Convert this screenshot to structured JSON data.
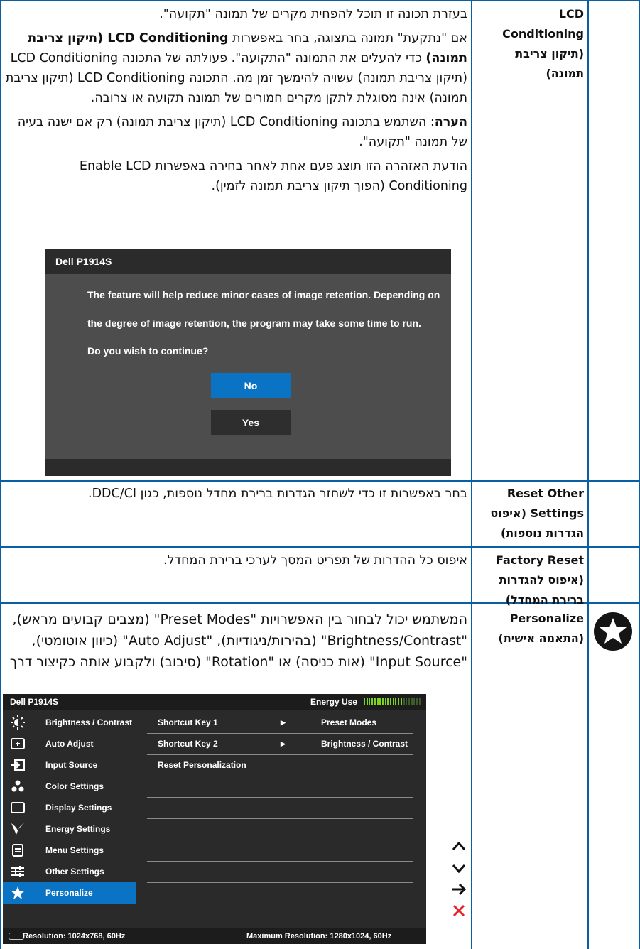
{
  "lcd": {
    "label": "LCD Conditioning (תיקון צריבת תמונה)",
    "p1": "בעזרת תכונה זו תוכל להפחית מקרים של תמונה \"תקועה\".",
    "p2_pre": "אם \"נתקעת\" תמונה בתצוגה, בחר באפשרות ",
    "p2_bold": "LCD Conditioning (תיקון צריבת תמונה)",
    "p2_post": " כדי להעלים את התמונה \"התקועה\". פעולתה של התכונה LCD Conditioning (תיקון צריבת תמונה) עשויה להימשך זמן מה. התכונה LCD Conditioning (תיקון צריבת תמונה) אינה מסוגלת לתקן מקרים חמורים של תמונה תקועה או צרובה.",
    "note_bold": "הערה",
    "note_text": ": השתמש בתכונה LCD Conditioning (תיקון צריבת תמונה) רק אם ישנה בעיה של תמונה \"תקועה\".",
    "p4": "הודעת האזהרה הזו תוצג פעם אחת לאחר בחירה באפשרות Enable LCD Conditioning (הפוך תיקון צריבת תמונה לזמין)."
  },
  "dialog": {
    "title": "Dell P1914S",
    "line1": "The feature will help reduce minor cases of image retention. Depending on",
    "line2": "the degree of image retention, the program may take some time to run.",
    "line3": "Do you wish to continue?",
    "no_label": "No",
    "yes_label": "Yes",
    "no_color": "#0a73c4",
    "yes_color": "#2e2e2e"
  },
  "reset_other": {
    "label": "Reset Other Settings (איפוס הגדרות נוספות)",
    "text": "בחר באפשרות זו כדי לשחזר הגדרות ברירת מחדל נוספות, כגון DDC/CI."
  },
  "factory_reset": {
    "label": "Factory Reset (איפוס להגדרות ברירת המחדל)",
    "text": "איפוס כל ההדרות של תפריט המסך לערכי ברירת המחדל."
  },
  "personalize": {
    "label": "Personalize (התאמה אישית)",
    "text": "המשתמש יכול לבחור בין האפשרויות \"Preset Modes\" (מצבים קבועים מראש), \"Brightness/Contrast\" (בהירות/ניגודיות), \"Auto Adjust\" (כיוון אוטומטי), \"Input Source\" (אות כניסה) או \"Rotation\" (סיבוב) ולקבוע אותה כקיצור דרך",
    "icon": "star-icon"
  },
  "osd": {
    "model": "Dell P1914S",
    "energy_label": "Energy Use",
    "energy_level": 0.7,
    "menu": [
      {
        "label": "Brightness / Contrast",
        "icon": "brightness-icon"
      },
      {
        "label": "Auto Adjust",
        "icon": "auto-adjust-icon"
      },
      {
        "label": "Input Source",
        "icon": "input-source-icon"
      },
      {
        "label": "Color Settings",
        "icon": "color-settings-icon"
      },
      {
        "label": "Display Settings",
        "icon": "display-settings-icon"
      },
      {
        "label": "Energy Settings",
        "icon": "energy-settings-icon"
      },
      {
        "label": "Menu Settings",
        "icon": "menu-settings-icon"
      },
      {
        "label": "Other Settings",
        "icon": "other-settings-icon"
      },
      {
        "label": "Personalize",
        "icon": "star-icon"
      }
    ],
    "rows": [
      {
        "label": "Shortcut Key 1",
        "value": "Preset Modes"
      },
      {
        "label": "Shortcut Key 2",
        "value": "Brightness / Contrast"
      },
      {
        "label": "Reset Personalization",
        "value": ""
      }
    ],
    "selected_color": "#0a73c4",
    "resolution": "Resolution: 1024x768,  60Hz",
    "max_resolution": "Maximum Resolution: 1280x1024,  60Hz"
  },
  "nav_buttons": [
    "up-arrow-icon",
    "down-arrow-icon",
    "right-arrow-icon",
    "close-icon"
  ]
}
